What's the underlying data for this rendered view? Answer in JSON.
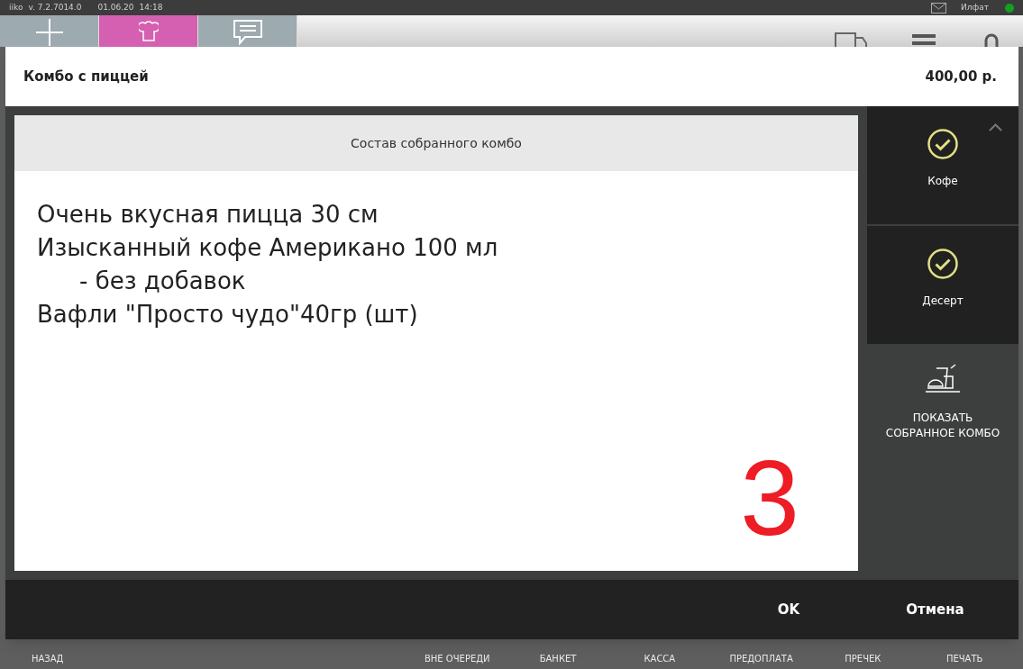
{
  "status_bar": {
    "app": "iiko",
    "version": "v. 7.2.7014.0",
    "date": "01.06.20",
    "time": "14:18",
    "user": "Илфат",
    "online": true
  },
  "toolbar": {
    "tiles": [
      {
        "kind": "add",
        "selected": false
      },
      {
        "kind": "chef",
        "selected": true
      },
      {
        "kind": "chat",
        "selected": false
      }
    ]
  },
  "dialog": {
    "title": "Комбо с пиццей",
    "price": "400,00 р.",
    "panel": {
      "heading": "Состав собранного комбо",
      "items": [
        {
          "text": "Очень вкусная пицца 30 см"
        },
        {
          "text": "Изысканный кофе Американо 100 мл",
          "children": [
            {
              "text": "- без добавок"
            }
          ]
        },
        {
          "text": "Вафли \"Просто чудо\"40гр (шт)"
        }
      ],
      "annotation": "3"
    },
    "side": [
      {
        "kind": "category",
        "label": "Кофе",
        "checked": true
      },
      {
        "kind": "category",
        "label": "Десерт",
        "checked": true
      },
      {
        "kind": "action",
        "label": "ПОКАЗАТЬ СОБРАННОЕ КОМБО"
      }
    ],
    "buttons": [
      "OK",
      "Отмена"
    ]
  },
  "bottom_bar": [
    "НАЗАД",
    "ВНЕ ОЧЕРЕДИ",
    "БАНКЕТ",
    "КАССА",
    "ПРЕДОПЛАТА",
    "ПРЕЧЕК",
    "ПЕЧАТЬ"
  ]
}
